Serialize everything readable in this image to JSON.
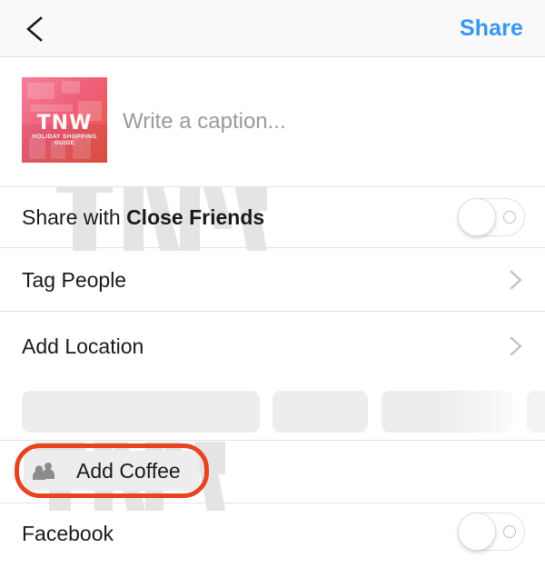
{
  "header": {
    "back_icon": "chevron-left-icon",
    "share_label": "Share"
  },
  "post": {
    "thumbnail": {
      "logo_text": "TNW",
      "subtitle_text": "HOLIDAY SHOPPING GUIDE",
      "gradient_from": "#f06a8a",
      "gradient_to": "#ef5a3c"
    },
    "caption": {
      "value": "",
      "placeholder": "Write a caption..."
    }
  },
  "options": [
    {
      "name": "close-friends",
      "label_prefix": "Share with ",
      "label_strong": "Close Friends",
      "control": "toggle",
      "state": "off"
    },
    {
      "name": "tag-people",
      "label": "Tag People",
      "control": "chevron"
    },
    {
      "name": "add-location",
      "label": "Add Location",
      "control": "chevron"
    }
  ],
  "suggestions": {
    "placeholder_count": 4
  },
  "chip": {
    "icon": "people-icon",
    "label": "Add Coffee"
  },
  "highlight": {
    "color": "#e8431f",
    "target": "Add Coffee"
  },
  "share_targets": [
    {
      "name": "facebook",
      "label": "Facebook",
      "control": "toggle",
      "state": "off"
    }
  ],
  "watermark": {
    "text": "TNW",
    "color": "#e4e4e4"
  }
}
